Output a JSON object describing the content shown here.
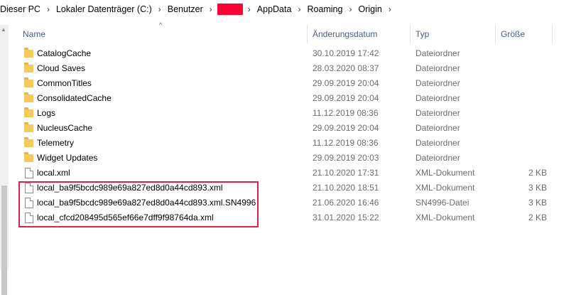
{
  "breadcrumb": [
    "Dieser PC",
    "Lokaler Datenträger (C:)",
    "Benutzer",
    "AppData",
    "Roaming",
    "Origin"
  ],
  "columns": {
    "name": "Name",
    "date": "Änderungsdatum",
    "type": "Typ",
    "size": "Größe"
  },
  "sort_indicator": "^",
  "files": [
    {
      "name": "CatalogCache",
      "date": "30.10.2019 17:42",
      "type": "Dateiordner",
      "size": "",
      "icon": "folder-icon"
    },
    {
      "name": "Cloud Saves",
      "date": "28.03.2020 08:37",
      "type": "Dateiordner",
      "size": "",
      "icon": "folder-icon"
    },
    {
      "name": "CommonTitles",
      "date": "29.09.2019 20:04",
      "type": "Dateiordner",
      "size": "",
      "icon": "folder-icon"
    },
    {
      "name": "ConsolidatedCache",
      "date": "29.09.2019 20:04",
      "type": "Dateiordner",
      "size": "",
      "icon": "folder-icon"
    },
    {
      "name": "Logs",
      "date": "11.12.2019 08:36",
      "type": "Dateiordner",
      "size": "",
      "icon": "folder-icon"
    },
    {
      "name": "NucleusCache",
      "date": "29.09.2019 20:04",
      "type": "Dateiordner",
      "size": "",
      "icon": "folder-icon"
    },
    {
      "name": "Telemetry",
      "date": "11.12.2019 08:36",
      "type": "Dateiordner",
      "size": "",
      "icon": "folder-icon"
    },
    {
      "name": "Widget Updates",
      "date": "29.09.2019 20:03",
      "type": "Dateiordner",
      "size": "",
      "icon": "folder-icon"
    },
    {
      "name": "local.xml",
      "date": "21.10.2020 17:31",
      "type": "XML-Dokument",
      "size": "2 KB",
      "icon": "file-icon"
    },
    {
      "name": "local_ba9f5bcdc989e69a827ed8d0a44cd893.xml",
      "date": "21.10.2020 18:51",
      "type": "XML-Dokument",
      "size": "3 KB",
      "icon": "file-icon"
    },
    {
      "name": "local_ba9f5bcdc989e69a827ed8d0a44cd893.xml.SN4996",
      "date": "21.06.2020 16:46",
      "type": "SN4996-Datei",
      "size": "3 KB",
      "icon": "file-icon"
    },
    {
      "name": "local_cfcd208495d565ef66e7dff9f98764da.xml",
      "date": "31.01.2020 15:22",
      "type": "XML-Dokument",
      "size": "2 KB",
      "icon": "file-icon"
    }
  ],
  "colors": {
    "highlight": "#e0204a",
    "redaction": "#ff0033",
    "header_text": "#4c607a",
    "folder": "#f6c95d"
  }
}
